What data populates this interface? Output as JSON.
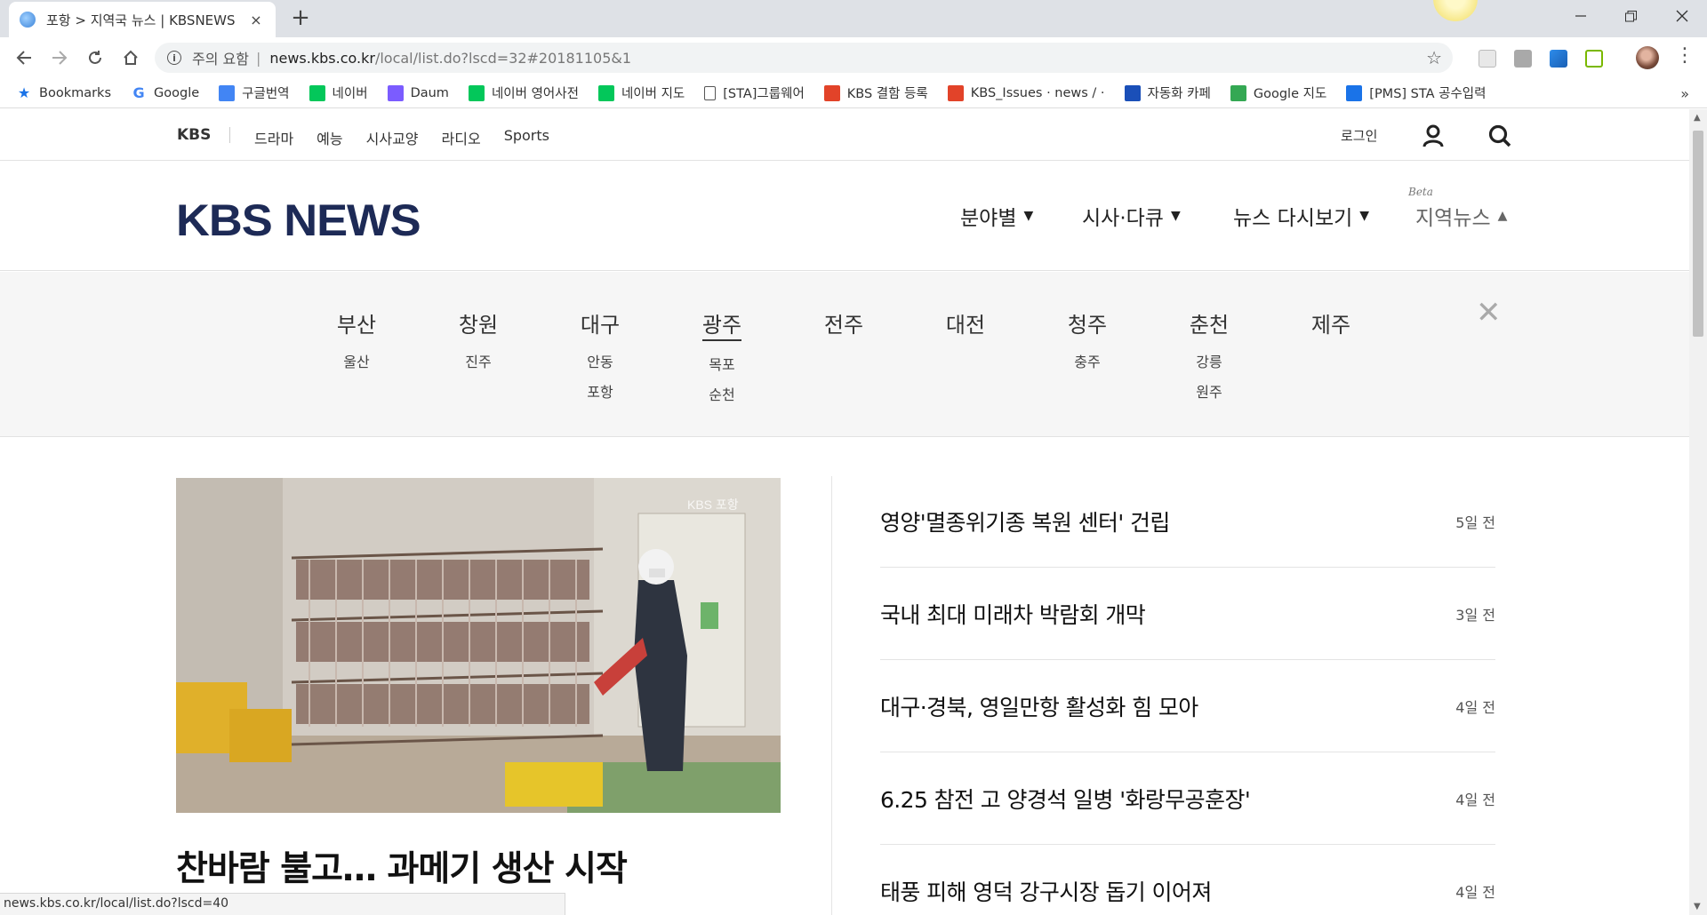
{
  "browser": {
    "tab_title": "포항 > 지역국 뉴스 | KBSNEWS",
    "tab_close": "×",
    "new_tab": "+",
    "security_label": "주의 요함",
    "separator": "|",
    "url_host": "news.kbs.co.kr",
    "url_path": "/local/list.do?lscd=32#20181105&1",
    "status_url": "news.kbs.co.kr/local/list.do?lscd=40",
    "more_bookmarks": "»"
  },
  "bookmarks": [
    {
      "label": "Bookmarks",
      "icon": "star-icon",
      "color": "#1a73e8"
    },
    {
      "label": "Google",
      "icon": "google-icon",
      "color": "#4285f4"
    },
    {
      "label": "구글번역",
      "icon": "translate-icon",
      "color": "#4285f4"
    },
    {
      "label": "네이버",
      "icon": "naver-icon",
      "color": "#03c75a"
    },
    {
      "label": "Daum",
      "icon": "daum-icon",
      "color": "#7b5cff"
    },
    {
      "label": "네이버 영어사전",
      "icon": "naver-dict-icon",
      "color": "#03c75a"
    },
    {
      "label": "네이버 지도",
      "icon": "naver-map-icon",
      "color": "#03c75a"
    },
    {
      "label": "[STA]그룹웨어",
      "icon": "page-icon",
      "color": "#ffffff"
    },
    {
      "label": "KBS 결함 등록",
      "icon": "gitlab-icon",
      "color": "#e24329"
    },
    {
      "label": "KBS_Issues · news / ·",
      "icon": "gitlab-icon",
      "color": "#e24329"
    },
    {
      "label": "자동화 카페",
      "icon": "sta-icon",
      "color": "#1a4fb8"
    },
    {
      "label": "Google 지도",
      "icon": "maps-icon",
      "color": "#34a853"
    },
    {
      "label": "[PMS] STA 공수입력",
      "icon": "pms-icon",
      "color": "#1a73e8"
    }
  ],
  "gnb": {
    "brand": "KBS",
    "links": [
      "드라마",
      "예능",
      "시사교양",
      "라디오",
      "Sports"
    ],
    "login": "로그인"
  },
  "header": {
    "logo": "KBS NEWS",
    "menus": [
      "분야별",
      "시사·다큐",
      "뉴스 다시보기",
      "지역뉴스"
    ],
    "beta": "Beta"
  },
  "regions": [
    {
      "name": "부산",
      "subs": [
        "울산"
      ]
    },
    {
      "name": "창원",
      "subs": [
        "진주"
      ]
    },
    {
      "name": "대구",
      "subs": [
        "안동",
        "포항"
      ]
    },
    {
      "name": "광주",
      "subs": [
        "목포",
        "순천"
      ],
      "active": true
    },
    {
      "name": "전주",
      "subs": []
    },
    {
      "name": "대전",
      "subs": []
    },
    {
      "name": "청주",
      "subs": [
        "충주"
      ]
    },
    {
      "name": "춘천",
      "subs": [
        "강릉",
        "원주"
      ]
    },
    {
      "name": "제주",
      "subs": []
    }
  ],
  "region_close": "✕",
  "lead": {
    "title": "찬바람 불고… 과메기 생산 시작",
    "image_watermark": "KBS 포항"
  },
  "news": [
    {
      "title": "영양'멸종위기종 복원 센터' 건립",
      "time": "5일 전"
    },
    {
      "title": "국내 최대 미래차 박람회 개막",
      "time": "3일 전"
    },
    {
      "title": "대구·경북, 영일만항 활성화 힘 모아",
      "time": "4일 전"
    },
    {
      "title": "6.25 참전 고 양경석 일병 '화랑무공훈장'",
      "time": "4일 전"
    },
    {
      "title": "태풍 피해 영덕 강구시장 돕기 이어져",
      "time": "4일 전"
    }
  ]
}
